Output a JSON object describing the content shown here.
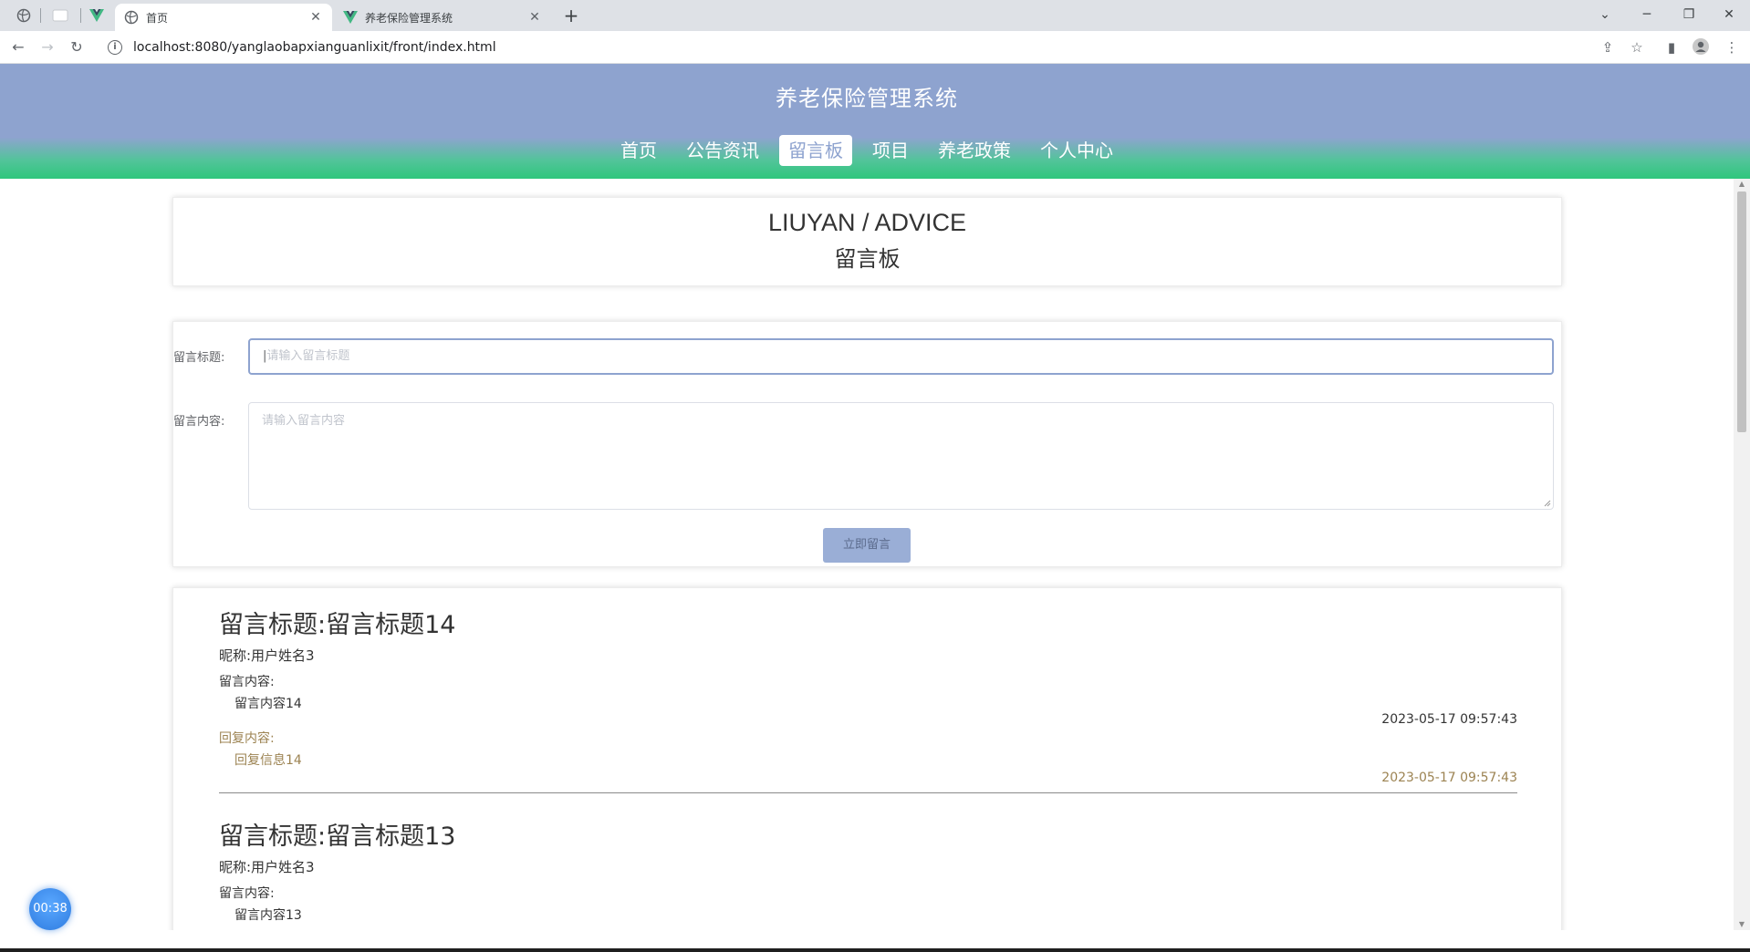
{
  "browser": {
    "tabs": [
      {
        "title": "首页",
        "active": true
      },
      {
        "title": "养老保险管理系统",
        "active": false
      }
    ],
    "url": "localhost:8080/yanglaobapxianguanlixit/front/index.html"
  },
  "site": {
    "title": "养老保险管理系统",
    "nav": [
      "首页",
      "公告资讯",
      "留言板",
      "项目",
      "养老政策",
      "个人中心"
    ],
    "active_nav": "留言板"
  },
  "page_heading": {
    "english": "LIUYAN / ADVICE",
    "chinese": "留言板"
  },
  "form": {
    "title_label": "留言标题:",
    "title_placeholder": "请输入留言标题",
    "content_label": "留言内容:",
    "content_placeholder": "请输入留言内容",
    "submit_label": "立即留言"
  },
  "messages": [
    {
      "title": "留言标题:留言标题14",
      "nickname": "昵称:用户姓名3",
      "content_label": "留言内容:",
      "content": "留言内容14",
      "time": "2023-05-17 09:57:43",
      "reply_label": "回复内容:",
      "reply": "回复信息14",
      "reply_time": "2023-05-17 09:57:43"
    },
    {
      "title": "留言标题:留言标题13",
      "nickname": "昵称:用户姓名3",
      "content_label": "留言内容:",
      "content": "留言内容13"
    }
  ],
  "timer": "00:38",
  "colors": {
    "header_blue": "#8ea3cf",
    "header_green": "#2fc67c",
    "reply_text": "#9c8352",
    "submit_bg": "#9aaed6"
  }
}
